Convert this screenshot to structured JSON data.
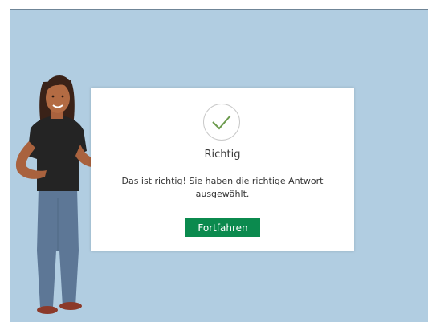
{
  "feedback": {
    "title": "Richtig",
    "message": "Das ist richtig!  Sie haben die richtige Antwort ausgewählt.",
    "continue_label": "Fortfahren",
    "icon": "checkmark-icon"
  },
  "colors": {
    "stage_background": "#b1cde1",
    "accent_green": "#0b8a4e",
    "check_green": "#6b9a4c"
  }
}
